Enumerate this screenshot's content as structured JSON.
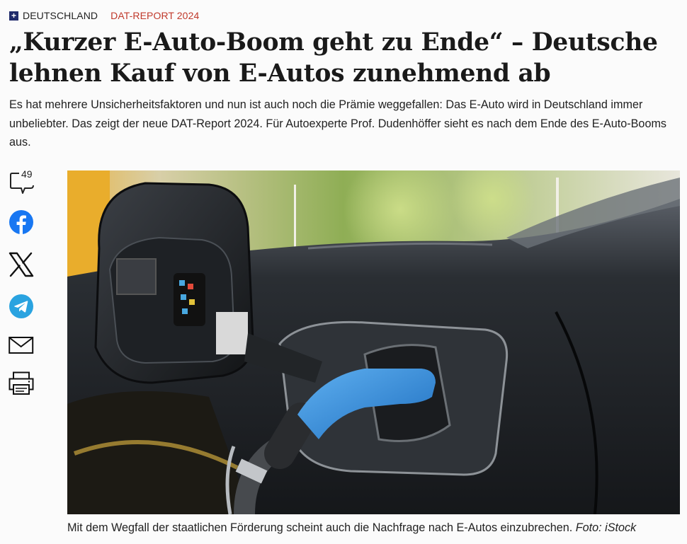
{
  "article": {
    "category": "DEUTSCHLAND",
    "topic": "DAT-REPORT 2024",
    "headline": "„Kurzer E-Auto-Boom geht zu Ende“ – Deutsche lehnen Kauf von E-Autos zunehmend ab",
    "lead": "Es hat mehrere Unsicherheitsfaktoren und nun ist auch noch die Prämie weggefallen: Das E-Auto wird in Deutschland immer unbeliebter. Das zeigt der neue DAT-Report 2024. Für Autoexperte Prof. Dudenhöffer sieht es nach dem Ende des E-Auto-Booms aus."
  },
  "share": {
    "comment_count": "49",
    "icons": [
      "comment-icon",
      "facebook-icon",
      "x-icon",
      "telegram-icon",
      "mail-icon",
      "print-icon"
    ]
  },
  "image": {
    "caption": "Mit dem Wegfall der staatlichen Förderung scheint auch die Nachfrage nach E-Autos einzubrechen.",
    "credit": "Foto: iStock"
  },
  "colors": {
    "topic": "#c0392b",
    "plus_badge": "#1f2a6b",
    "facebook": "#1877f2",
    "telegram": "#2aa3e0",
    "connector_blue": "#2f86d6"
  }
}
